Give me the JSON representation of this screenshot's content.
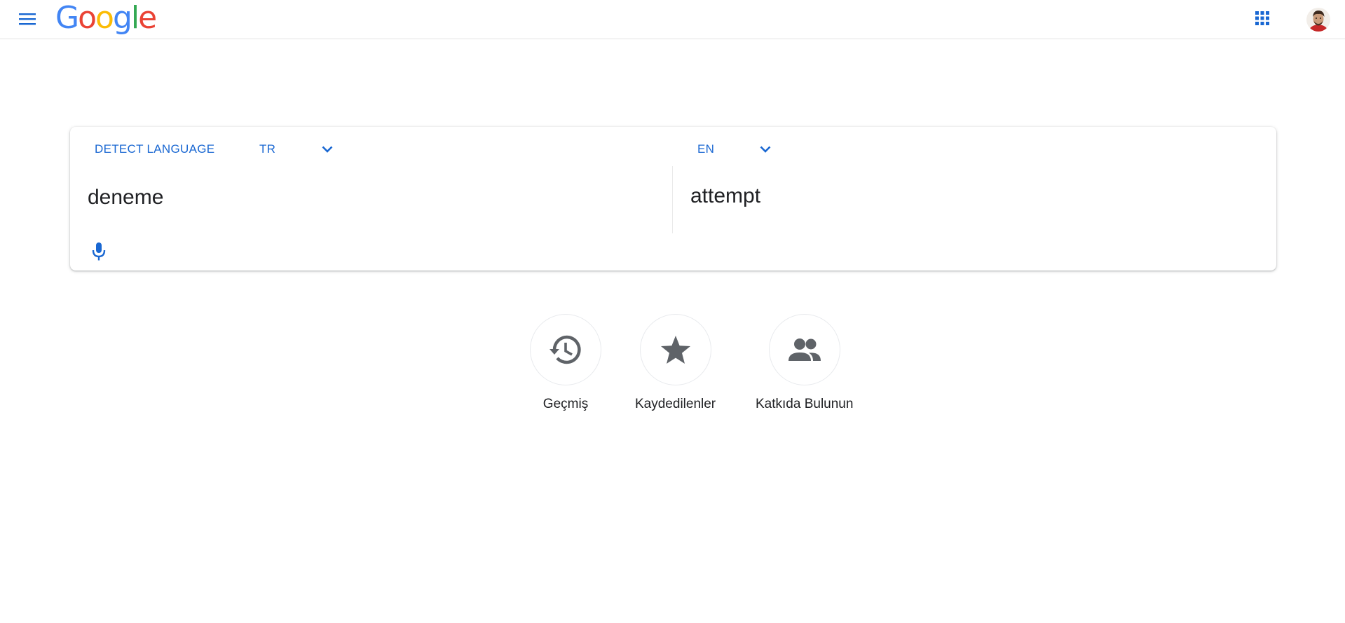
{
  "header": {
    "logo_letters": [
      {
        "char": "G",
        "color": "#4285F4"
      },
      {
        "char": "o",
        "color": "#EA4335"
      },
      {
        "char": "o",
        "color": "#FBBC05"
      },
      {
        "char": "g",
        "color": "#4285F4"
      },
      {
        "char": "l",
        "color": "#34A853"
      },
      {
        "char": "e",
        "color": "#EA4335"
      }
    ],
    "icons": {
      "menu": "menu-icon",
      "apps": "apps-grid-icon",
      "avatar": "user-avatar"
    }
  },
  "translator": {
    "source_tabs": {
      "detect": "DETECT LANGUAGE",
      "selected": "TR"
    },
    "target_tabs": {
      "selected": "EN"
    },
    "source_text": "deneme",
    "target_text": "attempt",
    "icons": {
      "mic": "mic-icon",
      "source_dropdown": "chevron-down-icon",
      "target_dropdown": "chevron-down-icon"
    }
  },
  "actions": [
    {
      "label": "Geçmiş",
      "icon": "history-icon"
    },
    {
      "label": "Kaydedilenler",
      "icon": "star-icon"
    },
    {
      "label": "Katkıda Bulunun",
      "icon": "people-icon"
    }
  ],
  "colors": {
    "accent": "#1967D2",
    "icon_gray": "#5F6368",
    "text": "#202124"
  }
}
